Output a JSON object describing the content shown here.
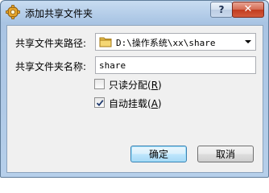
{
  "window": {
    "title": "添加共享文件夹",
    "help_label": "?",
    "close_label": "✕"
  },
  "form": {
    "path_label": "共享文件夹路径:",
    "path_value": "D:\\操作系统\\xx\\share",
    "name_label": "共享文件夹名称:",
    "name_value": "share"
  },
  "options": {
    "readonly": {
      "label": "只读分配",
      "mnemonic": "R",
      "checked": false
    },
    "automount": {
      "label": "自动挂载",
      "mnemonic": "A",
      "checked": true
    }
  },
  "buttons": {
    "ok_label": "确定",
    "cancel_label": "取消"
  },
  "colors": {
    "titlebar": "#b3cce8",
    "close_button": "#c13c1f",
    "default_button_border": "#3c7fb1"
  },
  "icons": {
    "title": "settings-gear-icon",
    "path": "folder-icon"
  }
}
